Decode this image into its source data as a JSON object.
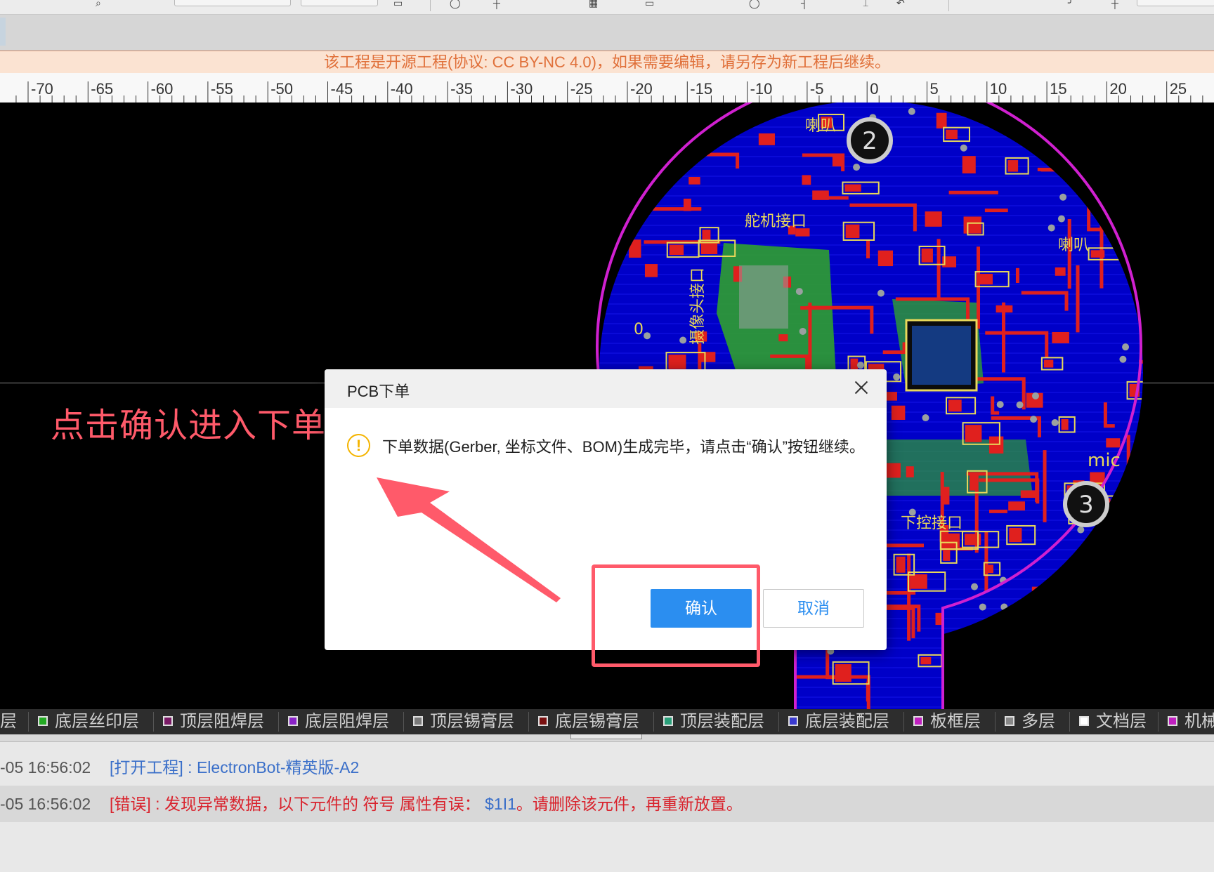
{
  "toolbar": {
    "icons": [
      "search-icon",
      "dropdown-icon",
      "dropdown-icon",
      "save-icon",
      "circle-icon",
      "crosshair-icon",
      "chip-icon",
      "box-icon",
      "circle-icon",
      "measure-icon",
      "text-cursor-icon",
      "undo-icon",
      "redo-icon",
      "pin-icon",
      "settings-icon"
    ]
  },
  "notice": {
    "text": "该工程是开源工程(协议: CC BY-NC 4.0)，如果需要编辑，请另存为新工程后继续。"
  },
  "ruler": {
    "labels": [
      "-70",
      "-65",
      "-60",
      "-55",
      "-50",
      "-45",
      "-40",
      "-35",
      "-30",
      "-25",
      "-20",
      "-15",
      "-10",
      "-5",
      "0",
      "5",
      "10",
      "15",
      "20",
      "25"
    ]
  },
  "pcb": {
    "silk_labels": [
      "喇叭",
      "喇叭",
      "mic",
      "舵机接口",
      "下控接口",
      "摄像头接口",
      "0"
    ],
    "markers": [
      "2",
      "3"
    ],
    "colors": {
      "board": "#0000c8",
      "copper": "#e0201e",
      "silk": "#f0e060",
      "outline": "#d020d0",
      "pad": "#9aa0a0"
    }
  },
  "annotation": {
    "text": "点击确认进入下单页面",
    "color": "#ff5a6a"
  },
  "dialog": {
    "title": "PCB下单",
    "icon": "!",
    "message": "下单数据(Gerber, 坐标文件、BOM)生成完毕，请点击“确认”按钮继续。",
    "confirm_label": "确认",
    "cancel_label": "取消",
    "primary_color": "#2b8ef0"
  },
  "layers": [
    {
      "label": "层",
      "color": ""
    },
    {
      "label": "底层丝印层",
      "color": "#22aa22"
    },
    {
      "label": "顶层阻焊层",
      "color": "#7a1a66"
    },
    {
      "label": "底层阻焊层",
      "color": "#8a22c8"
    },
    {
      "label": "顶层锡膏层",
      "color": "#7a7a7a"
    },
    {
      "label": "底层锡膏层",
      "color": "#7a1010"
    },
    {
      "label": "顶层装配层",
      "color": "#2aa07a"
    },
    {
      "label": "底层装配层",
      "color": "#3a3ad0"
    },
    {
      "label": "板框层",
      "color": "#c020c0"
    },
    {
      "label": "多层",
      "color": "#888888"
    },
    {
      "label": "文档层",
      "color": "#ffffff"
    },
    {
      "label": "机械",
      "color": "#c020c0"
    }
  ],
  "log": [
    {
      "time": "-05 16:56:02",
      "tag": "[打开工程]",
      "text": " : ElectronBot-精英版-A2",
      "type": "info"
    },
    {
      "time": "-05 16:56:02",
      "tag": "[错误]",
      "text": " : 发现异常数据，以下元件的 符号 属性有误：",
      "ref": "$1I1",
      "tail": "。请删除该元件，再重新放置。",
      "type": "error"
    }
  ]
}
